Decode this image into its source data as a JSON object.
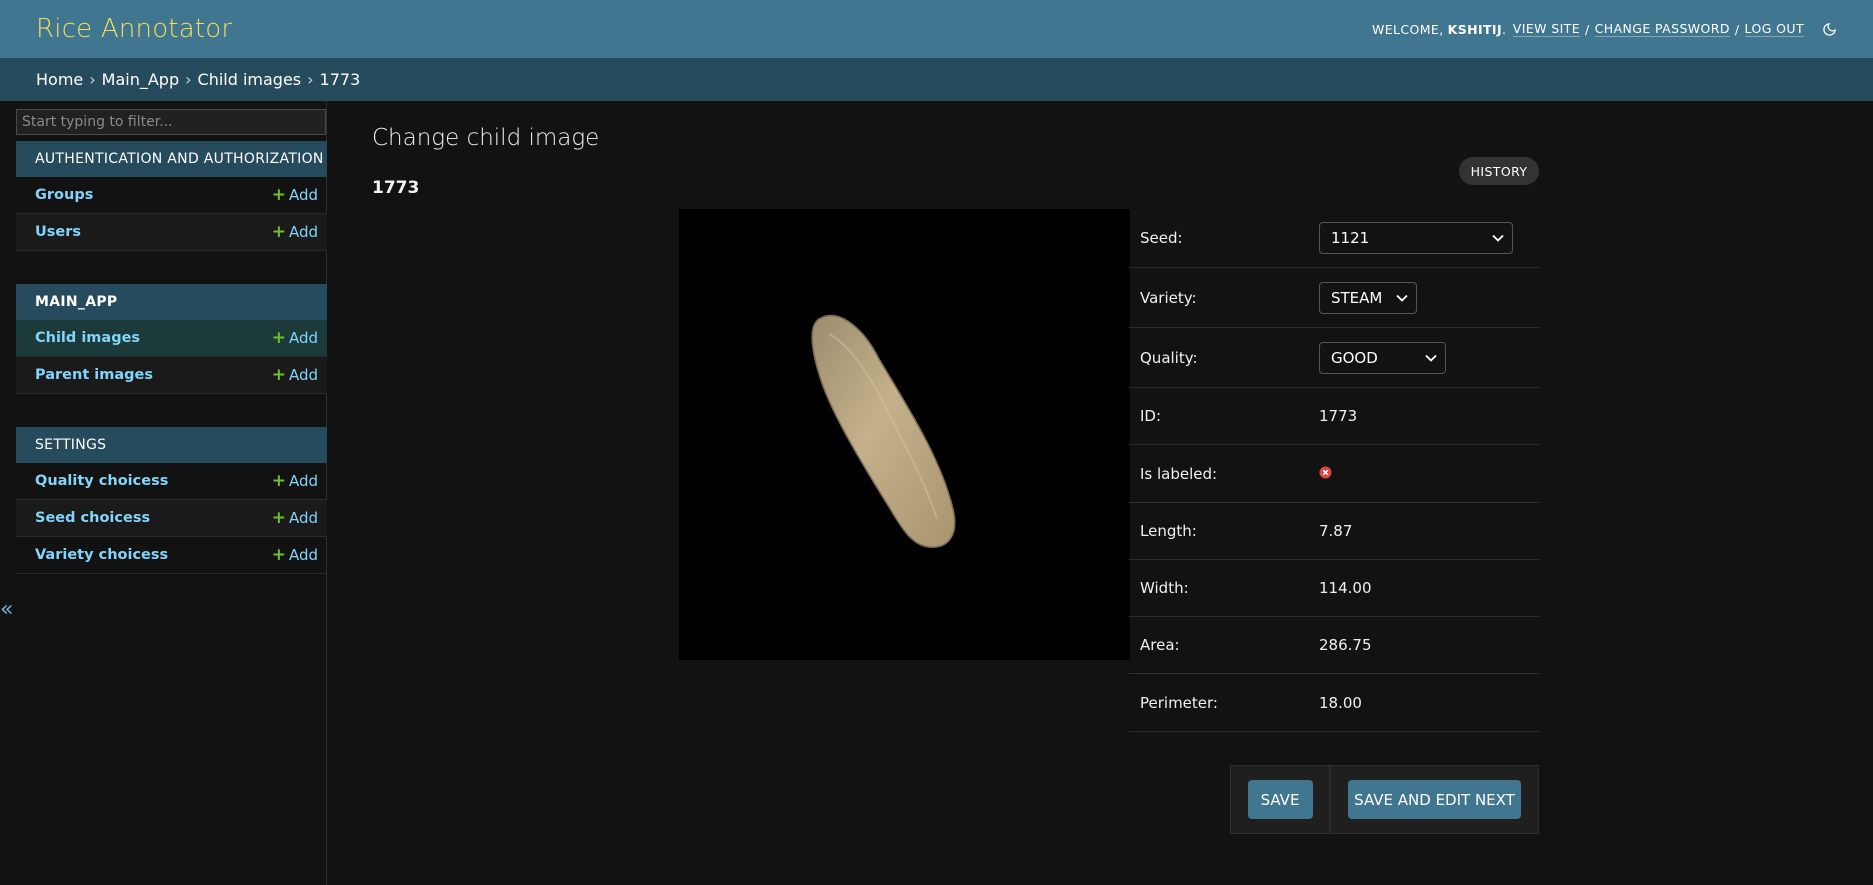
{
  "header": {
    "brand": "Rice Annotator",
    "welcome": "WELCOME,",
    "username": "KSHITIJ",
    "view_site": "VIEW SITE",
    "change_password": "CHANGE PASSWORD",
    "log_out": "LOG OUT",
    "separator": "/",
    "theme_icon": "moon-icon"
  },
  "breadcrumbs": {
    "items": [
      "Home",
      "Main_App",
      "Child images"
    ],
    "current": "1773",
    "separator": "›"
  },
  "sidebar": {
    "filter_placeholder": "Start typing to filter...",
    "collapse_glyph": "«",
    "add_label": "Add",
    "modules": [
      {
        "caption": "AUTHENTICATION AND AUTHORIZATION",
        "models": [
          "Groups",
          "Users"
        ]
      },
      {
        "caption": "MAIN_APP",
        "models": [
          "Child images",
          "Parent images"
        ]
      },
      {
        "caption": "SETTINGS",
        "models": [
          "Quality choicess",
          "Seed choicess",
          "Variety choicess"
        ]
      }
    ],
    "active_model": "Child images"
  },
  "content": {
    "title": "Change child image",
    "subtitle": "1773",
    "history_label": "HISTORY",
    "image_alt": "rice grain",
    "fields": [
      {
        "label": "Seed:",
        "value": "1121",
        "type": "select"
      },
      {
        "label": "Variety:",
        "value": "STEAM",
        "type": "select"
      },
      {
        "label": "Quality:",
        "value": "GOOD",
        "type": "select"
      },
      {
        "label": "ID:",
        "value": "1773",
        "type": "text"
      },
      {
        "label": "Is labeled:",
        "value": "false",
        "type": "icon",
        "icon": "icon-no"
      },
      {
        "label": "Length:",
        "value": "7.87",
        "type": "text"
      },
      {
        "label": "Width:",
        "value": "114.00",
        "type": "text"
      },
      {
        "label": "Area:",
        "value": "286.75",
        "type": "text"
      },
      {
        "label": "Perimeter:",
        "value": "18.00",
        "type": "text"
      }
    ],
    "save_label": "SAVE",
    "save_next_label": "SAVE AND EDIT NEXT"
  },
  "colors": {
    "header_bg": "#417690",
    "brand": "#f5dd5d",
    "breadcrumbs_bg": "#264b5d",
    "link": "#81d4fa",
    "add_plus": "#70bf2b",
    "danger": "#dd4646"
  }
}
